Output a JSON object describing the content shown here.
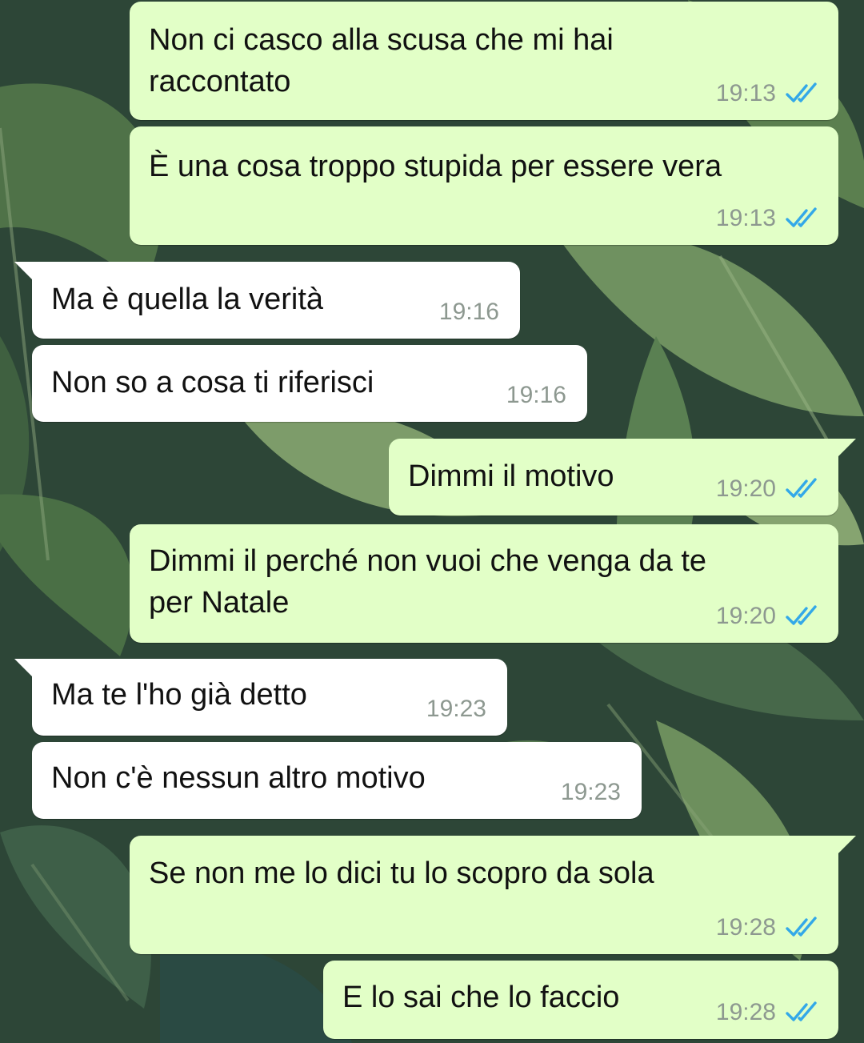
{
  "chat": {
    "colors": {
      "outgoing_bubble": "#e2ffc7",
      "incoming_bubble": "#ffffff",
      "read_ticks": "#33a8e8",
      "timestamp": "#8d9890"
    },
    "status_icon": "double-check-read-icon",
    "messages": [
      {
        "direction": "outgoing",
        "lines": [
          "Non ci casco alla scusa che mi hai",
          "raccontato"
        ],
        "time": "19:13",
        "status": "read"
      },
      {
        "direction": "outgoing",
        "lines": [
          "È una cosa troppo stupida per essere vera"
        ],
        "time": "19:13",
        "status": "read"
      },
      {
        "direction": "incoming",
        "lines": [
          "Ma è quella la verità"
        ],
        "time": "19:16"
      },
      {
        "direction": "incoming",
        "lines": [
          "Non so a cosa ti riferisci"
        ],
        "time": "19:16"
      },
      {
        "direction": "outgoing",
        "lines": [
          "Dimmi il motivo"
        ],
        "time": "19:20",
        "status": "read"
      },
      {
        "direction": "outgoing",
        "lines": [
          "Dimmi il perché non vuoi che venga da te",
          "per Natale"
        ],
        "time": "19:20",
        "status": "read"
      },
      {
        "direction": "incoming",
        "lines": [
          "Ma te l'ho già detto"
        ],
        "time": "19:23"
      },
      {
        "direction": "incoming",
        "lines": [
          "Non c'è nessun altro motivo"
        ],
        "time": "19:23"
      },
      {
        "direction": "outgoing",
        "lines": [
          "Se non me lo dici tu lo scopro da sola"
        ],
        "time": "19:28",
        "status": "read"
      },
      {
        "direction": "outgoing",
        "lines": [
          "E lo sai che lo faccio"
        ],
        "time": "19:28",
        "status": "read"
      }
    ]
  }
}
